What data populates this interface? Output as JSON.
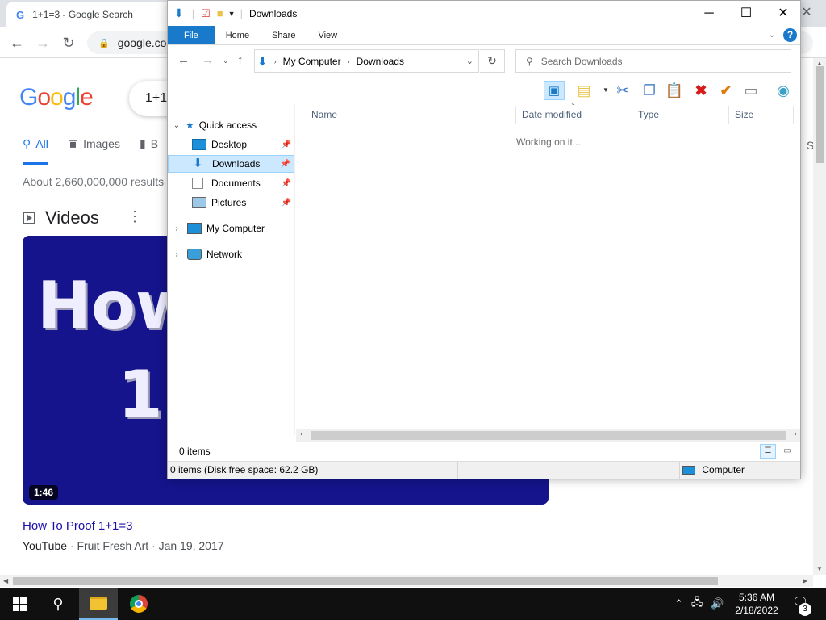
{
  "chrome": {
    "tab_title": "1+1=3 - Google Search",
    "url": "google.com",
    "close_glyph": "✕"
  },
  "google": {
    "logo": [
      "G",
      "o",
      "o",
      "g",
      "l",
      "e"
    ],
    "query_partial": "1+1",
    "tabs": [
      {
        "label": "All",
        "icon": "search-icon",
        "active": true
      },
      {
        "label": "Images",
        "icon": "image-icon"
      },
      {
        "label": "B",
        "icon": "book-icon"
      }
    ],
    "tab_right": "S",
    "results_count": "About 2,660,000,000 results",
    "videos_heading": "Videos",
    "video": {
      "thumb_line1": "How",
      "thumb_line2": "1",
      "duration": "1:46",
      "title": "How To Proof 1+1=3",
      "source": "YouTube",
      "meta": " · Fruit Fresh Art · Jan 19, 2017"
    }
  },
  "explorer": {
    "title": "Downloads",
    "ribbon_tabs": [
      "File",
      "Home",
      "Share",
      "View"
    ],
    "breadcrumb": [
      "My Computer",
      "Downloads"
    ],
    "search_placeholder": "Search Downloads",
    "nav": {
      "quick_access": "Quick access",
      "items": [
        "Desktop",
        "Downloads",
        "Documents",
        "Pictures"
      ],
      "my_computer": "My Computer",
      "network": "Network"
    },
    "columns": [
      "Name",
      "Date modified",
      "Type",
      "Size"
    ],
    "working_text": "Working on it...",
    "item_count": "0 items",
    "status_detail": "0 items (Disk free space: 62.2 GB)",
    "status_location": "Computer"
  },
  "taskbar": {
    "time": "5:36 AM",
    "date": "2/18/2022",
    "notification_count": "3"
  },
  "colors": {
    "accent": "#1979ca",
    "selection": "#cce8ff",
    "video_bg": "#15148c",
    "link": "#1a0dab"
  }
}
